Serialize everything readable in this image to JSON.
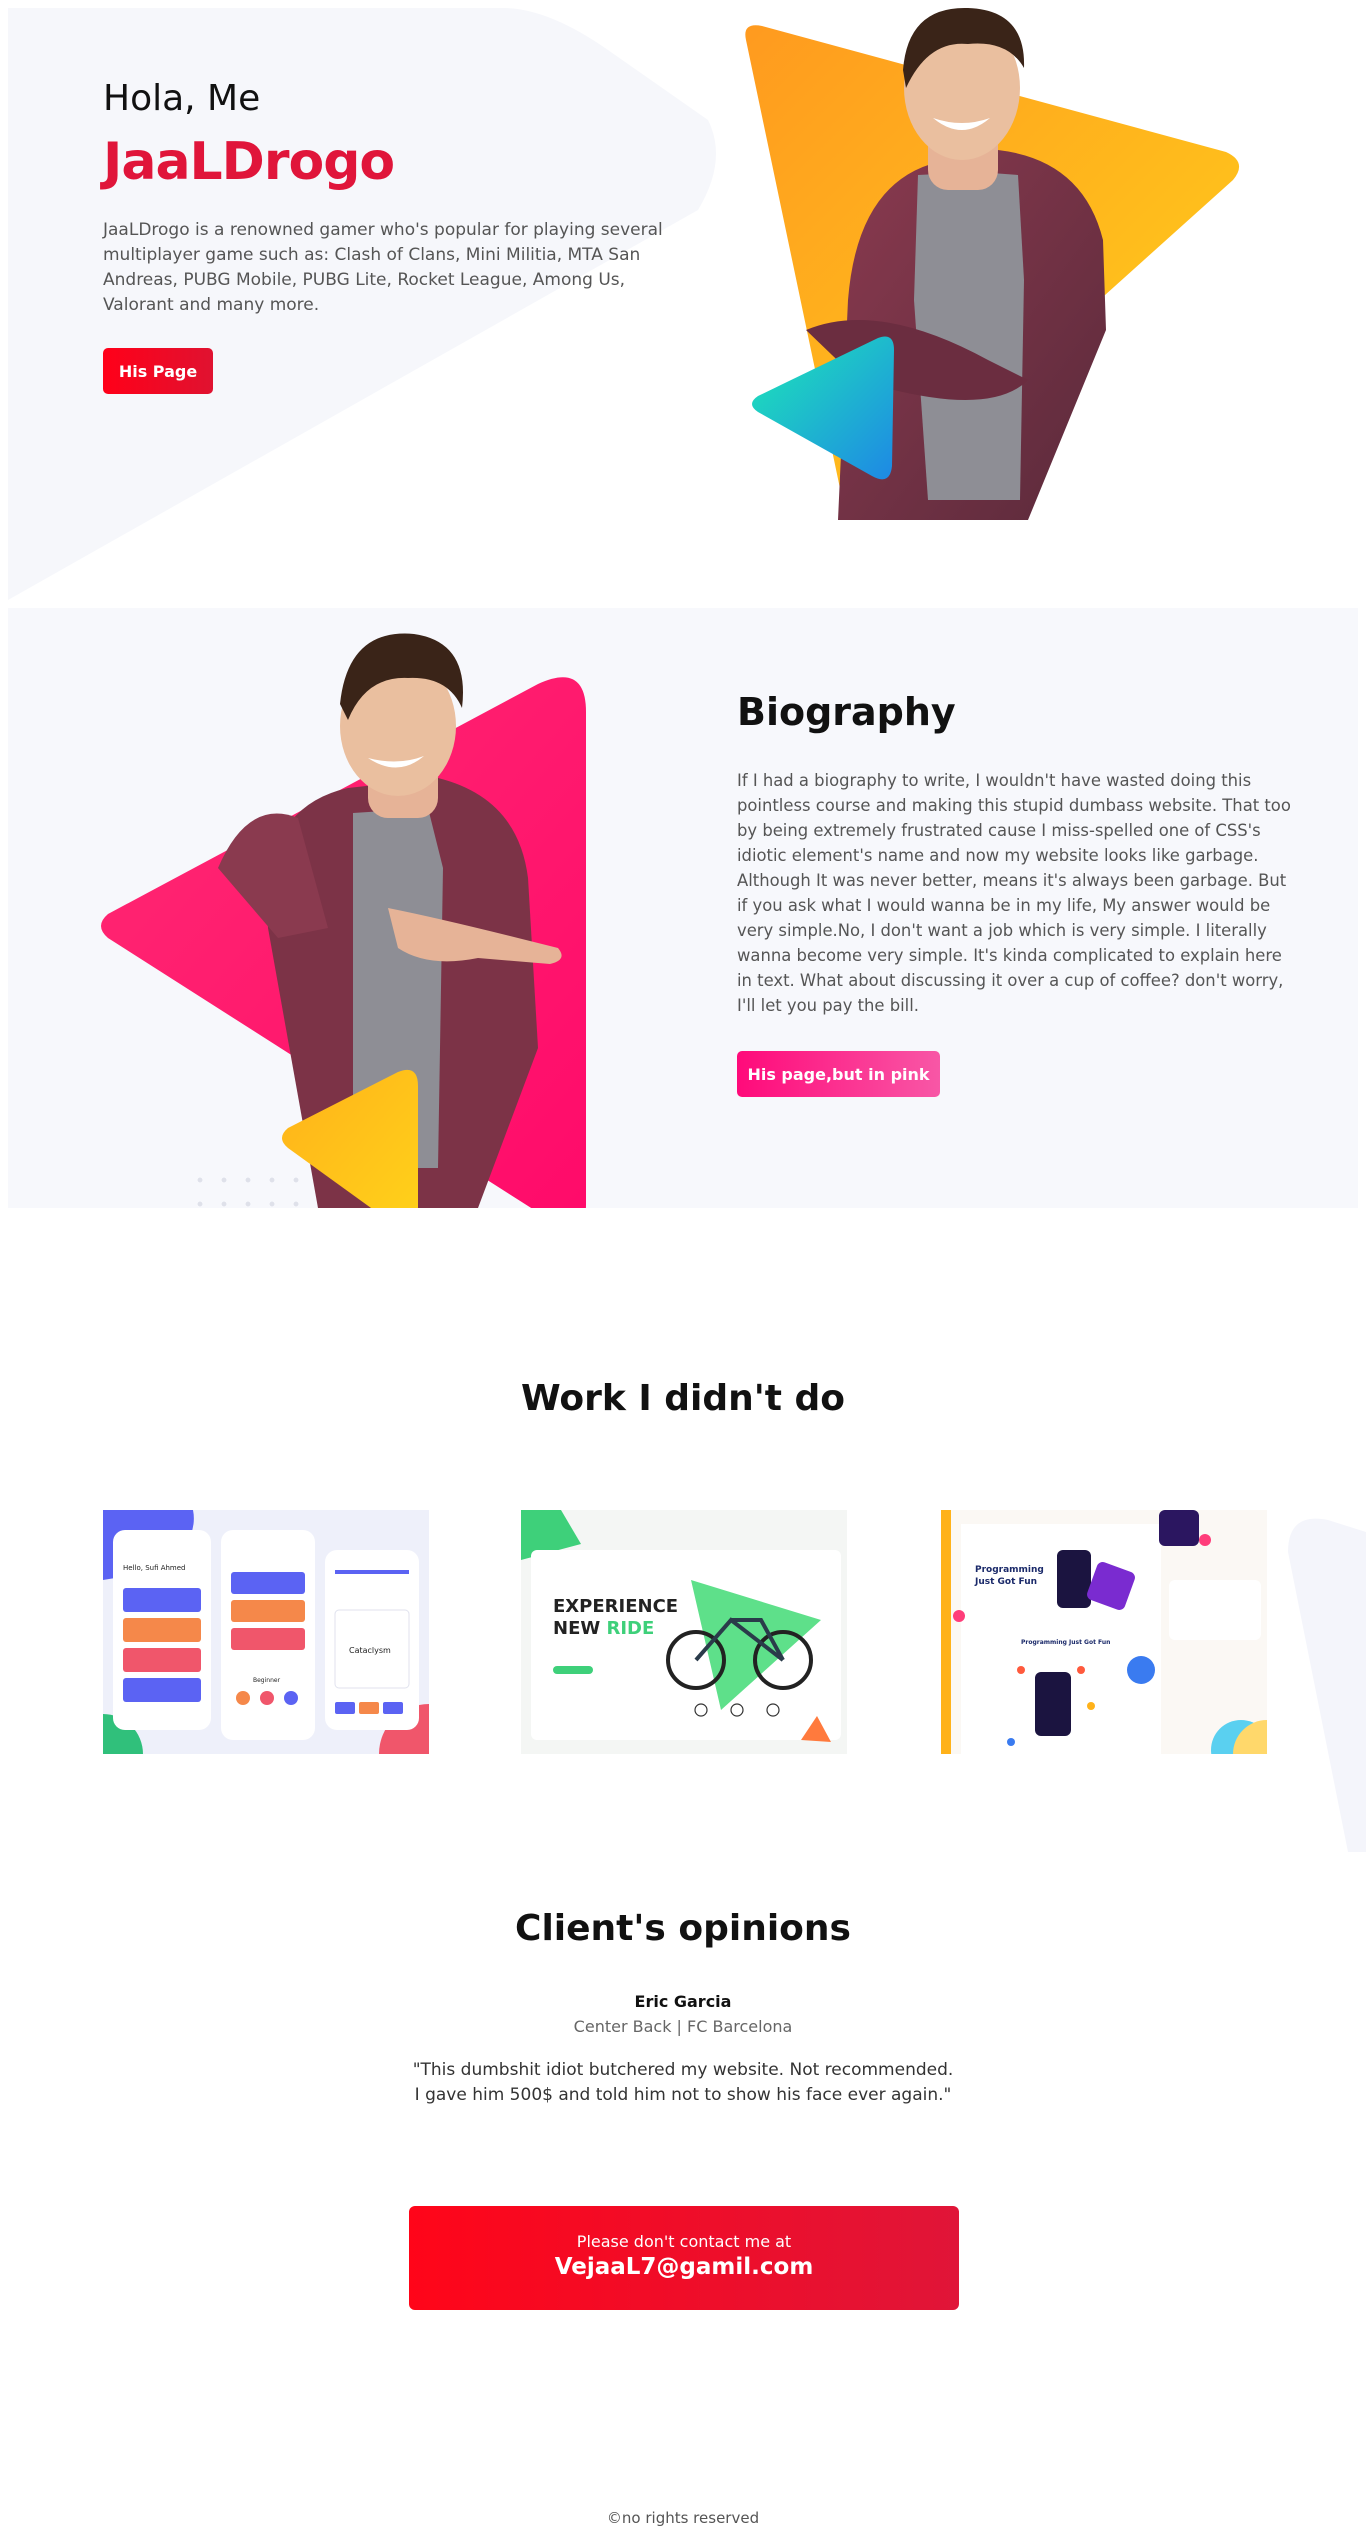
{
  "hero": {
    "greeting": "Hola, Me",
    "name": "JaaLDrogo",
    "description": "JaaLDrogo is a renowned gamer who's popular for playing several multiplayer game such as: Clash of Clans, Mini Militia, MTA San Andreas, PUBG Mobile, PUBG Lite, Rocket League, Among Us, Valorant and many more.",
    "button_label": "His Page"
  },
  "biography": {
    "title": "Biography",
    "text": "If I had a biography to write, I wouldn't have wasted doing this pointless course and making this stupid dumbass website. That too by being extremely frustrated cause I miss-spelled one of CSS's idiotic element's name and now my website looks like garbage. Although It was never better, means it's always been garbage. But if you ask what I would wanna be in my life, My answer would be very simple.No, I don't want a job which is very simple. I literally wanna become very simple. It's kinda complicated to explain here in text. What about discussing it over a cup of coffee? don't worry, I'll let you pay the bill.",
    "button_label": "His page,but in pink"
  },
  "work": {
    "title": "Work I didn't do",
    "cards": [
      {
        "heading": "Hello, Sufi Ahmed",
        "label": "Cataclysm",
        "tag": "Beginner"
      },
      {
        "heading_line1": "EXPERIENCE",
        "heading_line2_a": "NEW ",
        "heading_line2_b": "RIDE"
      },
      {
        "heading_line1": "Programming",
        "heading_line2": "Just Got Fun",
        "subheading": "Programming Just Got Fun"
      }
    ]
  },
  "opinions": {
    "title": "Client's opinions",
    "name": "Eric Garcia",
    "role": "Center Back | FC Barcelona",
    "quote_line1": "\"This dumbshit idiot butchered my website. Not recommended.",
    "quote_line2": "I gave him 500$ and told him not to show his face ever again.\""
  },
  "contact": {
    "label": "Please don't contact me at",
    "email": "VejaaL7@gamil.com"
  },
  "footer": {
    "text": "©no rights reserved"
  },
  "colors": {
    "brand_red": "#e0153a",
    "pink": "#ff0a7a",
    "orange": "#ff9a1f",
    "yellow": "#ffd21a",
    "teal": "#1de9b6",
    "blue": "#1e88e5"
  }
}
